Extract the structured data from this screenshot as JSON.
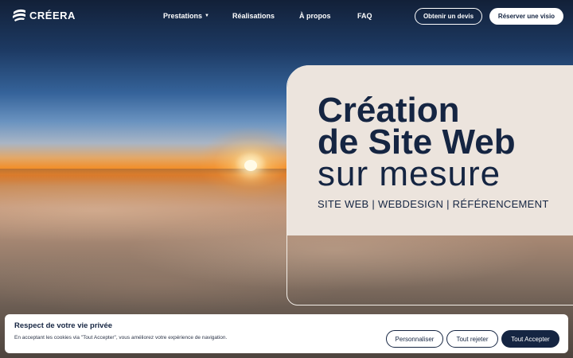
{
  "header": {
    "logo_text": "CRÉERA",
    "nav": [
      {
        "label": "Prestations",
        "has_dropdown": true
      },
      {
        "label": "Réalisations"
      },
      {
        "label": "À propos"
      },
      {
        "label": "FAQ"
      }
    ],
    "cta_quote": "Obtenir un devis",
    "cta_visio": "Réserver une visio"
  },
  "hero": {
    "line1": "Création",
    "line2": "de Site Web",
    "line3": "sur mesure",
    "tagline": "SITE WEB | WEBDESIGN | RÉFÉRENCEMENT"
  },
  "cookie": {
    "title": "Respect de votre vie privée",
    "text": "En acceptant les cookies via \"Tout Accepter\", vous améliorez votre expérience de navigation.",
    "customize": "Personnaliser",
    "reject": "Tout rejeter",
    "accept": "Tout Accepter"
  },
  "colors": {
    "brand_navy": "#152542",
    "card_beige": "#ece4dd"
  }
}
